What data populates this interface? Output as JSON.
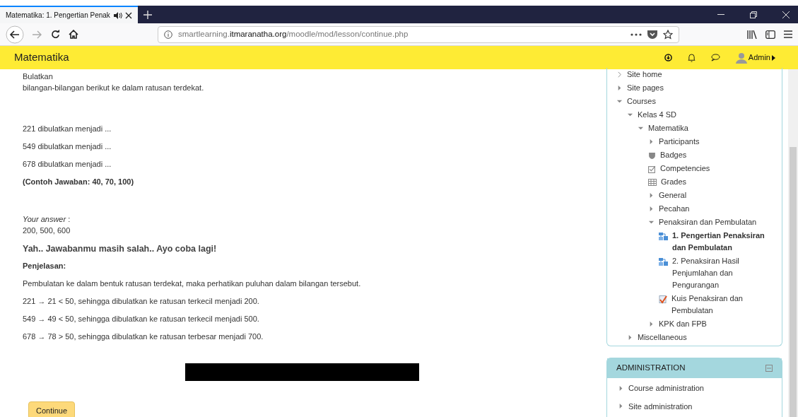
{
  "browser": {
    "tab_title": "Matematika: 1. Pengertian Penak",
    "url_host": "smartlearning.",
    "url_domain": "itmaranatha.org",
    "url_path": "/moodle/mod/lesson/continue.php"
  },
  "navbar": {
    "site_name": "Matematika",
    "user": "Admin"
  },
  "content": {
    "intro": [
      "Bulatkan",
      "bilangan-bilangan berikut ke dalam ratusan terdekat."
    ],
    "questions": [
      "221 dibulatkan menjadi ...",
      "549 dibulatkan menjadi ...",
      "678 dibulatkan menjadi ..."
    ],
    "example": "(Contoh Jawaban: 40, 70, 100)",
    "answer_label": "*Your answer* :",
    "answer_value": "200, 500, 600",
    "feedback": "Yah.. Jawabanmu masih salah.. Ayo coba lagi!",
    "explanation_title": "Penjelasan:",
    "explanation": [
      "Pembulatan ke dalam bentuk ratusan terdekat, maka perhatikan puluhan dalam bilangan tersebut.",
      "221 → 21 < 50, sehingga dibulatkan ke ratusan terkecil menjadi 200.",
      "549 → 49 < 50, sehingga dibulatkan ke ratusan terkecil menjadi 500.",
      "678 → 78 > 50, sehingga dibulatkan ke ratusan terbesar menjadi 700."
    ],
    "continue_button": "Continue"
  },
  "navigation": [
    {
      "label": "Site home",
      "kind": "page"
    },
    {
      "label": "Site pages",
      "kind": "branch",
      "expanded": false
    },
    {
      "label": "Courses",
      "kind": "branch",
      "expanded": true,
      "children": [
        {
          "label": "Kelas 4 SD",
          "kind": "branch",
          "expanded": true,
          "children": [
            {
              "label": "Matematika",
              "kind": "branch",
              "expanded": true,
              "children": [
                {
                  "label": "Participants",
                  "kind": "branch",
                  "expanded": false
                },
                {
                  "label": "Badges",
                  "kind": "badges"
                },
                {
                  "label": "Competencies",
                  "kind": "competencies"
                },
                {
                  "label": "Grades",
                  "kind": "grades"
                },
                {
                  "label": "General",
                  "kind": "branch",
                  "expanded": false
                },
                {
                  "label": "Pecahan",
                  "kind": "branch",
                  "expanded": false
                },
                {
                  "label": "Penaksiran dan Pembulatan",
                  "kind": "branch",
                  "expanded": true,
                  "children": [
                    {
                      "label": "1. Pengertian Penaksiran dan Pembulatan",
                      "kind": "lesson",
                      "selected": true
                    },
                    {
                      "label": "2. Penaksiran Hasil Penjumlahan dan Pengurangan",
                      "kind": "lesson",
                      "selected": false
                    },
                    {
                      "label": "Kuis Penaksiran dan Pembulatan",
                      "kind": "quiz",
                      "selected": false
                    }
                  ]
                },
                {
                  "label": "KPK dan FPB",
                  "kind": "branch",
                  "expanded": false
                }
              ]
            }
          ]
        },
        {
          "label": "Miscellaneous",
          "kind": "branch",
          "expanded": false
        }
      ]
    }
  ],
  "administration": {
    "title": "ADMINISTRATION",
    "items": [
      {
        "label": "Course administration",
        "expanded": false
      },
      {
        "label": "Site administration",
        "expanded": false
      }
    ]
  }
}
